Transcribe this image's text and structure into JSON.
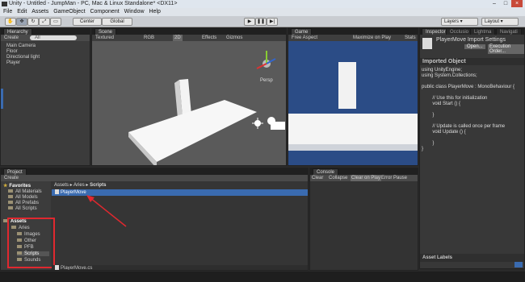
{
  "window": {
    "title": "Unity - Untitled - JumpMan - PC, Mac & Linux Standalone* <DX11>"
  },
  "menu": [
    "File",
    "Edit",
    "Assets",
    "GameObject",
    "Component",
    "Window",
    "Help"
  ],
  "toolbar": {
    "pivot_label": "Center",
    "space_label": "Global",
    "layers_label": "Layers",
    "layout_label": "Layout"
  },
  "hierarchy": {
    "tab": "Hierarchy",
    "create_label": "Create",
    "search_placeholder": "All",
    "items": [
      "Main Camera",
      "Floor",
      "Directional light",
      "Player"
    ]
  },
  "scene": {
    "tab": "Scene",
    "shading": "Textured",
    "render": "RGB",
    "mode_2d": "2D",
    "effects": "Effects",
    "gizmos": "Gizmos",
    "search_placeholder": "All",
    "persp_label": "Persp"
  },
  "game": {
    "tab": "Game",
    "aspect": "Free Aspect",
    "maximize": "Maximize on Play",
    "stats": "Stats",
    "gizmos": "Gizmos"
  },
  "inspector": {
    "tabs": [
      "Inspector",
      "Occlusio",
      "Lightma",
      "Navigati"
    ],
    "title": "PlayerMove Import Settings",
    "open_label": "Open...",
    "exec_label": "Execution Order...",
    "section": "Imported Object",
    "code": [
      "using UnityEngine;",
      "using System.Collections;",
      "",
      "public class PlayerMove : MonoBehaviour {",
      "",
      "        // Use this for initialization",
      "        void Start () {",
      "",
      "        }",
      "",
      "        // Update is called once per frame",
      "        void Update () {",
      "",
      "        }",
      "}"
    ],
    "asset_labels": "Asset Labels"
  },
  "project": {
    "tab": "Project",
    "create_label": "Create",
    "favorites_label": "Favorites",
    "favorites": [
      "All Materials",
      "All Models",
      "All Prefabs",
      "All Scripts"
    ],
    "assets_label": "Assets",
    "tree": [
      "Aries",
      "Images",
      "Other",
      "PFB",
      "Scripts",
      "Sounds"
    ],
    "breadcrumb": [
      "Assets",
      "Aries",
      "Scripts"
    ],
    "selected_file": "PlayerMove",
    "status_file": "PlayerMove.cs"
  },
  "console": {
    "tab": "Console",
    "buttons": [
      "Clear",
      "Collapse",
      "Clear on Play",
      "Error Pause"
    ]
  },
  "colors": {
    "game_sky": "#2b4c86",
    "selection": "#3a6bb0",
    "annotation_red": "#e0282f"
  }
}
